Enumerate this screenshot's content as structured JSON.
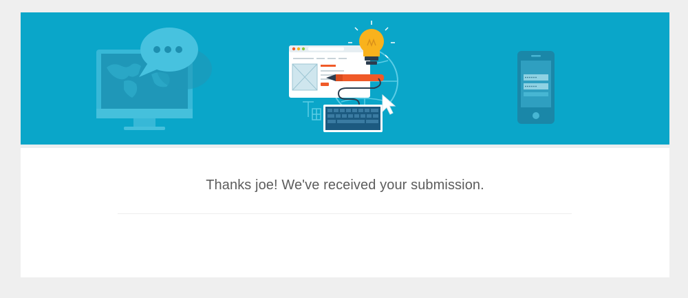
{
  "confirmation": {
    "message": "Thanks joe! We've received your submission."
  },
  "banner": {
    "background_color": "#0aa6c9",
    "illustrations": [
      "desktop-monitor-icon",
      "chat-bubble-icon",
      "browser-window-icon",
      "lightbulb-icon",
      "pen-icon",
      "keyboard-icon",
      "cursor-icon",
      "smartphone-icon"
    ]
  },
  "colors": {
    "page_background": "#efefef",
    "card_background": "#ffffff",
    "text": "#5c5c5c",
    "accent_orange": "#f05a28",
    "bulb_yellow": "#f9b21d"
  }
}
